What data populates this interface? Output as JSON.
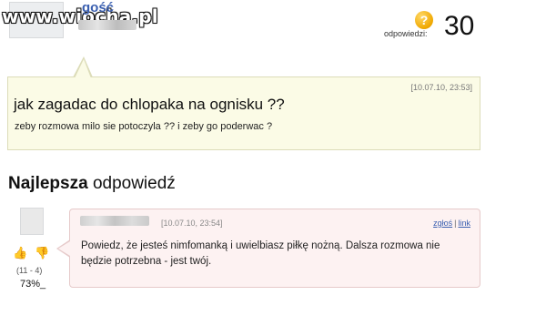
{
  "watermark": "www.wiocha.pl",
  "header": {
    "author_label": "gość",
    "answers_label": "odpowiedzi:",
    "answers_count": "30",
    "question_icon": "?"
  },
  "question": {
    "date": "[10.07.10, 23:53]",
    "title": "jak zagadac do chlopaka na ognisku ??",
    "text": "zeby rozmowa milo sie potoczyla ?? i zeby go poderwac ?"
  },
  "best_answer": {
    "heading_bold": "Najlepsza",
    "heading_rest": "odpowiedź",
    "date": "[10.07.10, 23:54]",
    "report_label": "zgłoś",
    "link_label": "link",
    "separator": "|",
    "text": "Powiedz, że jesteś nimfomanką i uwielbiasz piłkę nożną. Dalsza rozmowa nie będzie potrzebna - jest twój.",
    "votes": "(11 - 4)",
    "percent": "73%_",
    "thumb_up_icon": "thumbs-up-icon",
    "thumb_down_icon": "thumbs-down-icon"
  },
  "colors": {
    "question_bg": "#fbfbe6",
    "answer_bg": "#fdf2f2",
    "link": "#3a5fb0"
  }
}
